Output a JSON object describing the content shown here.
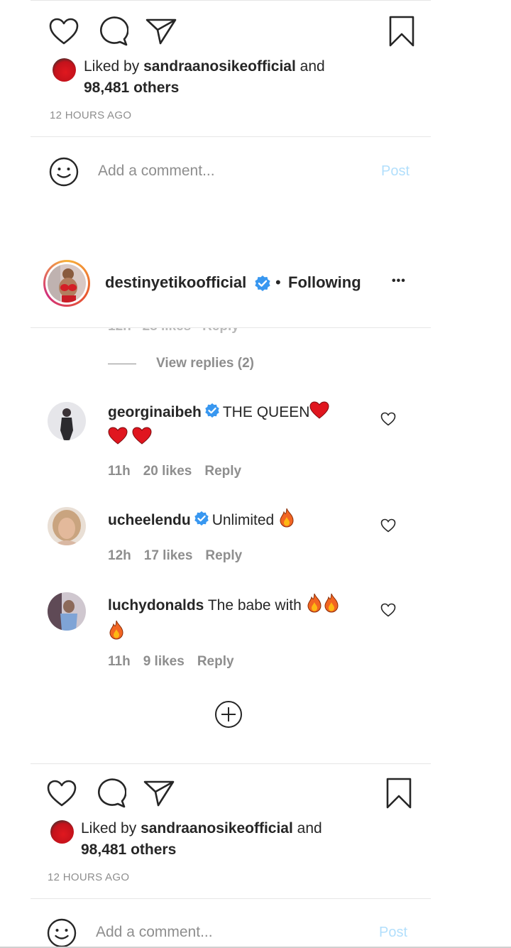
{
  "top_post": {
    "liked_prefix": "Liked by",
    "liked_user": "sandraanosikeofficial",
    "liked_and": "and",
    "liked_others": "98,481 others",
    "time": "12 HOURS AGO",
    "comment_placeholder": "Add a comment...",
    "post_label": "Post"
  },
  "header": {
    "username": "destinyetikoofficial",
    "separator": "•",
    "follow_status": "Following",
    "more": "•••"
  },
  "view_replies": "View replies (2)",
  "comments": [
    {
      "username": "georginaibeh",
      "text": "THE QUEEN",
      "time": "11h",
      "likes": "20 likes",
      "reply": "Reply"
    },
    {
      "username": "ucheelendu",
      "text": "Unlimited",
      "time": "12h",
      "likes": "17 likes",
      "reply": "Reply"
    },
    {
      "username": "luchydonalds",
      "text": "The babe with",
      "time": "11h",
      "likes": "9 likes",
      "reply": "Reply"
    }
  ],
  "bottom_post": {
    "liked_prefix": "Liked by",
    "liked_user": "sandraanosikeofficial",
    "liked_and": "and",
    "liked_others": "98,481 others",
    "time": "12 HOURS AGO",
    "comment_placeholder": "Add a comment...",
    "post_label": "Post"
  },
  "colors": {
    "verified": "#3897f0",
    "heart_emoji": "#e0161f",
    "post_disabled": "#b2dffc",
    "muted": "#8e8e8e"
  }
}
